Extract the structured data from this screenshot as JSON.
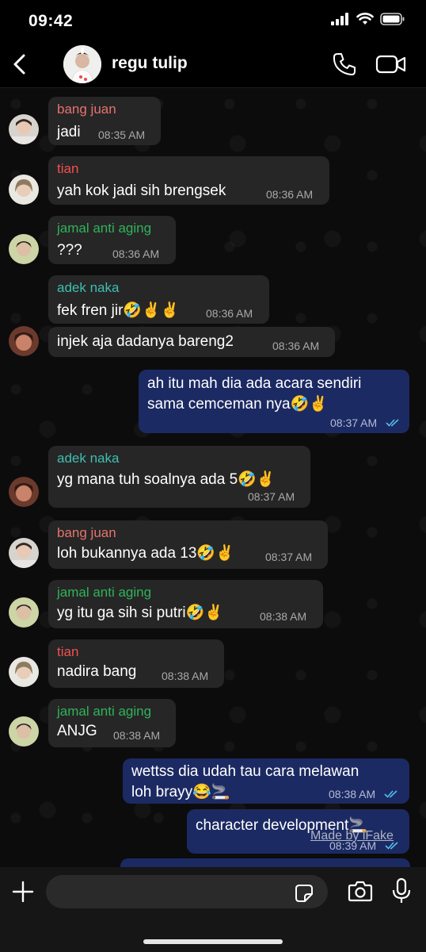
{
  "status_bar": {
    "time": "09:42"
  },
  "header": {
    "title": "regu tulip"
  },
  "colors": {
    "bang_juan": "#e5736f",
    "tian": "#f25050",
    "jamal": "#2fb35a",
    "adek_naka": "#3fbfb0",
    "incoming_bubble": "#262626",
    "outgoing_bubble": "#1c2a63",
    "read_ticks": "#53bdeb"
  },
  "messages": [
    {
      "sender": "bang juan",
      "text": "jadi",
      "time": "08:35 AM"
    },
    {
      "sender": "tian",
      "text": "yah kok jadi sih brengsek",
      "time": "08:36 AM"
    },
    {
      "sender": "jamal anti aging",
      "text": "???",
      "time": "08:36 AM"
    },
    {
      "sender": "adek naka",
      "text": "fek fren jir🤣✌️✌️",
      "time": "08:36 AM"
    },
    {
      "sender": "",
      "text": "injek aja dadanya bareng2",
      "time": "08:36 AM"
    },
    {
      "sender": "",
      "text_lines": [
        "ah itu mah dia ada acara sendiri",
        "sama cemceman nya🤣✌️"
      ],
      "time": "08:37 AM"
    },
    {
      "sender": "adek naka",
      "text": "yg mana tuh soalnya ada 5🤣✌️",
      "time": "08:37 AM"
    },
    {
      "sender": "bang juan",
      "text": "loh bukannya ada 13🤣✌️",
      "time": "08:37 AM"
    },
    {
      "sender": "jamal anti aging",
      "text": "yg itu ga sih si putri🤣✌️",
      "time": "08:38 AM"
    },
    {
      "sender": "tian",
      "text": "nadira bang",
      "time": "08:38 AM"
    },
    {
      "sender": "jamal anti aging",
      "text": "ANJG",
      "time": "08:38 AM"
    },
    {
      "sender": "",
      "text_lines": [
        "wettss dia udah tau cara melawan",
        "loh brayy😂🚬"
      ],
      "time": "08:38 AM"
    },
    {
      "sender": "",
      "text": "character development🚬",
      "time": "08:39 AM"
    }
  ],
  "watermark": "Made by iFake",
  "input": {
    "placeholder": ""
  },
  "icons": [
    "back-chevron-icon",
    "phone-icon",
    "video-icon",
    "plus-icon",
    "sticker-icon",
    "camera-icon",
    "mic-icon",
    "signal-icon",
    "wifi-icon",
    "battery-icon",
    "double-check-icon"
  ]
}
